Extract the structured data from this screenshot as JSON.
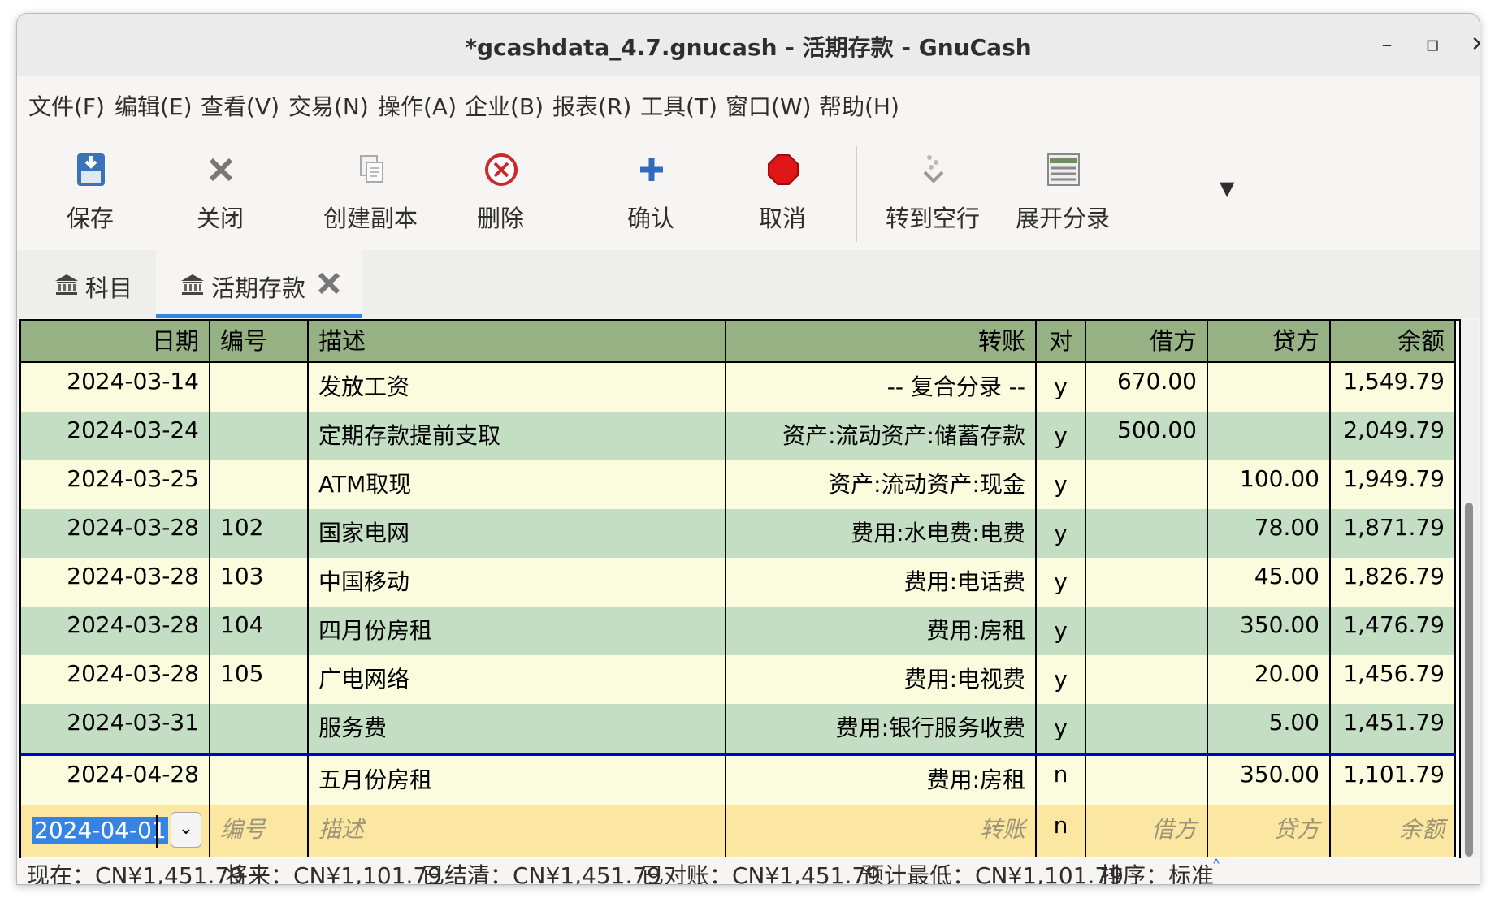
{
  "window": {
    "title": "*gcashdata_4.7.gnucash - 活期存款 - GnuCash"
  },
  "menu": [
    "文件(F)",
    "编辑(E)",
    "查看(V)",
    "交易(N)",
    "操作(A)",
    "企业(B)",
    "报表(R)",
    "工具(T)",
    "窗口(W)",
    "帮助(H)"
  ],
  "toolbar": {
    "save": "保存",
    "close": "关闭",
    "duplicate": "创建副本",
    "delete": "删除",
    "confirm": "确认",
    "cancel": "取消",
    "blank": "转到空行",
    "split": "展开分录"
  },
  "tabs": [
    {
      "label": "科目"
    },
    {
      "label": "活期存款"
    }
  ],
  "ledger": {
    "headers": {
      "date": "日期",
      "num": "编号",
      "desc": "描述",
      "transfer": "转账",
      "r": "对",
      "debit": "借方",
      "credit": "贷方",
      "balance": "余额"
    },
    "rows": [
      {
        "date": "2024-03-14",
        "num": "",
        "desc": "发放工资",
        "transfer": "-- 复合分录 --",
        "r": "y",
        "debit": "670.00",
        "credit": "",
        "balance": "1,549.79"
      },
      {
        "date": "2024-03-24",
        "num": "",
        "desc": "定期存款提前支取",
        "transfer": "资产:流动资产:储蓄存款",
        "r": "y",
        "debit": "500.00",
        "credit": "",
        "balance": "2,049.79"
      },
      {
        "date": "2024-03-25",
        "num": "",
        "desc": "ATM取现",
        "transfer": "资产:流动资产:现金",
        "r": "y",
        "debit": "",
        "credit": "100.00",
        "balance": "1,949.79"
      },
      {
        "date": "2024-03-28",
        "num": "102",
        "desc": "国家电网",
        "transfer": "费用:水电费:电费",
        "r": "y",
        "debit": "",
        "credit": "78.00",
        "balance": "1,871.79"
      },
      {
        "date": "2024-03-28",
        "num": "103",
        "desc": "中国移动",
        "transfer": "费用:电话费",
        "r": "y",
        "debit": "",
        "credit": "45.00",
        "balance": "1,826.79"
      },
      {
        "date": "2024-03-28",
        "num": "104",
        "desc": "四月份房租",
        "transfer": "费用:房租",
        "r": "y",
        "debit": "",
        "credit": "350.00",
        "balance": "1,476.79"
      },
      {
        "date": "2024-03-28",
        "num": "105",
        "desc": "广电网络",
        "transfer": "费用:电视费",
        "r": "y",
        "debit": "",
        "credit": "20.00",
        "balance": "1,456.79"
      },
      {
        "date": "2024-03-31",
        "num": "",
        "desc": "服务费",
        "transfer": "费用:银行服务收费",
        "r": "y",
        "debit": "",
        "credit": "5.00",
        "balance": "1,451.79"
      },
      {
        "date": "2024-04-28",
        "num": "",
        "desc": "五月份房租",
        "transfer": "费用:房租",
        "r": "n",
        "debit": "",
        "credit": "350.00",
        "balance": "1,101.79"
      }
    ],
    "blank": {
      "date": "2024-04-01",
      "num": "编号",
      "desc": "描述",
      "transfer": "转账",
      "r": "n",
      "debit": "借方",
      "credit": "贷方",
      "balance": "余额"
    }
  },
  "status": {
    "present": "现在：CN¥1,451.79",
    "future": "将来：CN¥1,101.79",
    "cleared": "已结清：CN¥1,451.79",
    "reconciled": "已对账：CN¥1,451.79",
    "projected_min": "预计最低：CN¥1,101.79",
    "sort": "排序：标准"
  },
  "colors": {
    "header": "#96b183",
    "row_yellow": "#fbfbdd",
    "row_green": "#c3dec3",
    "blank_row": "#fbe7a1",
    "divider": "#0000c8"
  }
}
